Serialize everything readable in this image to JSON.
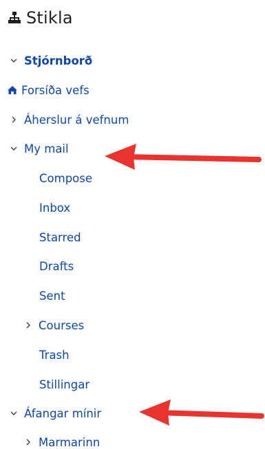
{
  "header": {
    "title": "Stikla",
    "icon": "sitemap-icon"
  },
  "nav": {
    "dashboard": "Stjórnborð",
    "site_home": "Forsíða vefs",
    "site_highlights": "Áherslur á vefnum",
    "my_mail": "My mail",
    "mail_items": {
      "compose": "Compose",
      "inbox": "Inbox",
      "starred": "Starred",
      "drafts": "Drafts",
      "sent": "Sent",
      "courses": "Courses",
      "trash": "Trash",
      "settings": "Stillingar"
    },
    "my_courses": "Áfangar mínir",
    "course_items": {
      "marmarinn": "Marmarinn"
    }
  },
  "colors": {
    "link": "#0f47ad",
    "text": "#1d2125",
    "chevron": "#3a3f44",
    "arrow": "#e8332f"
  }
}
